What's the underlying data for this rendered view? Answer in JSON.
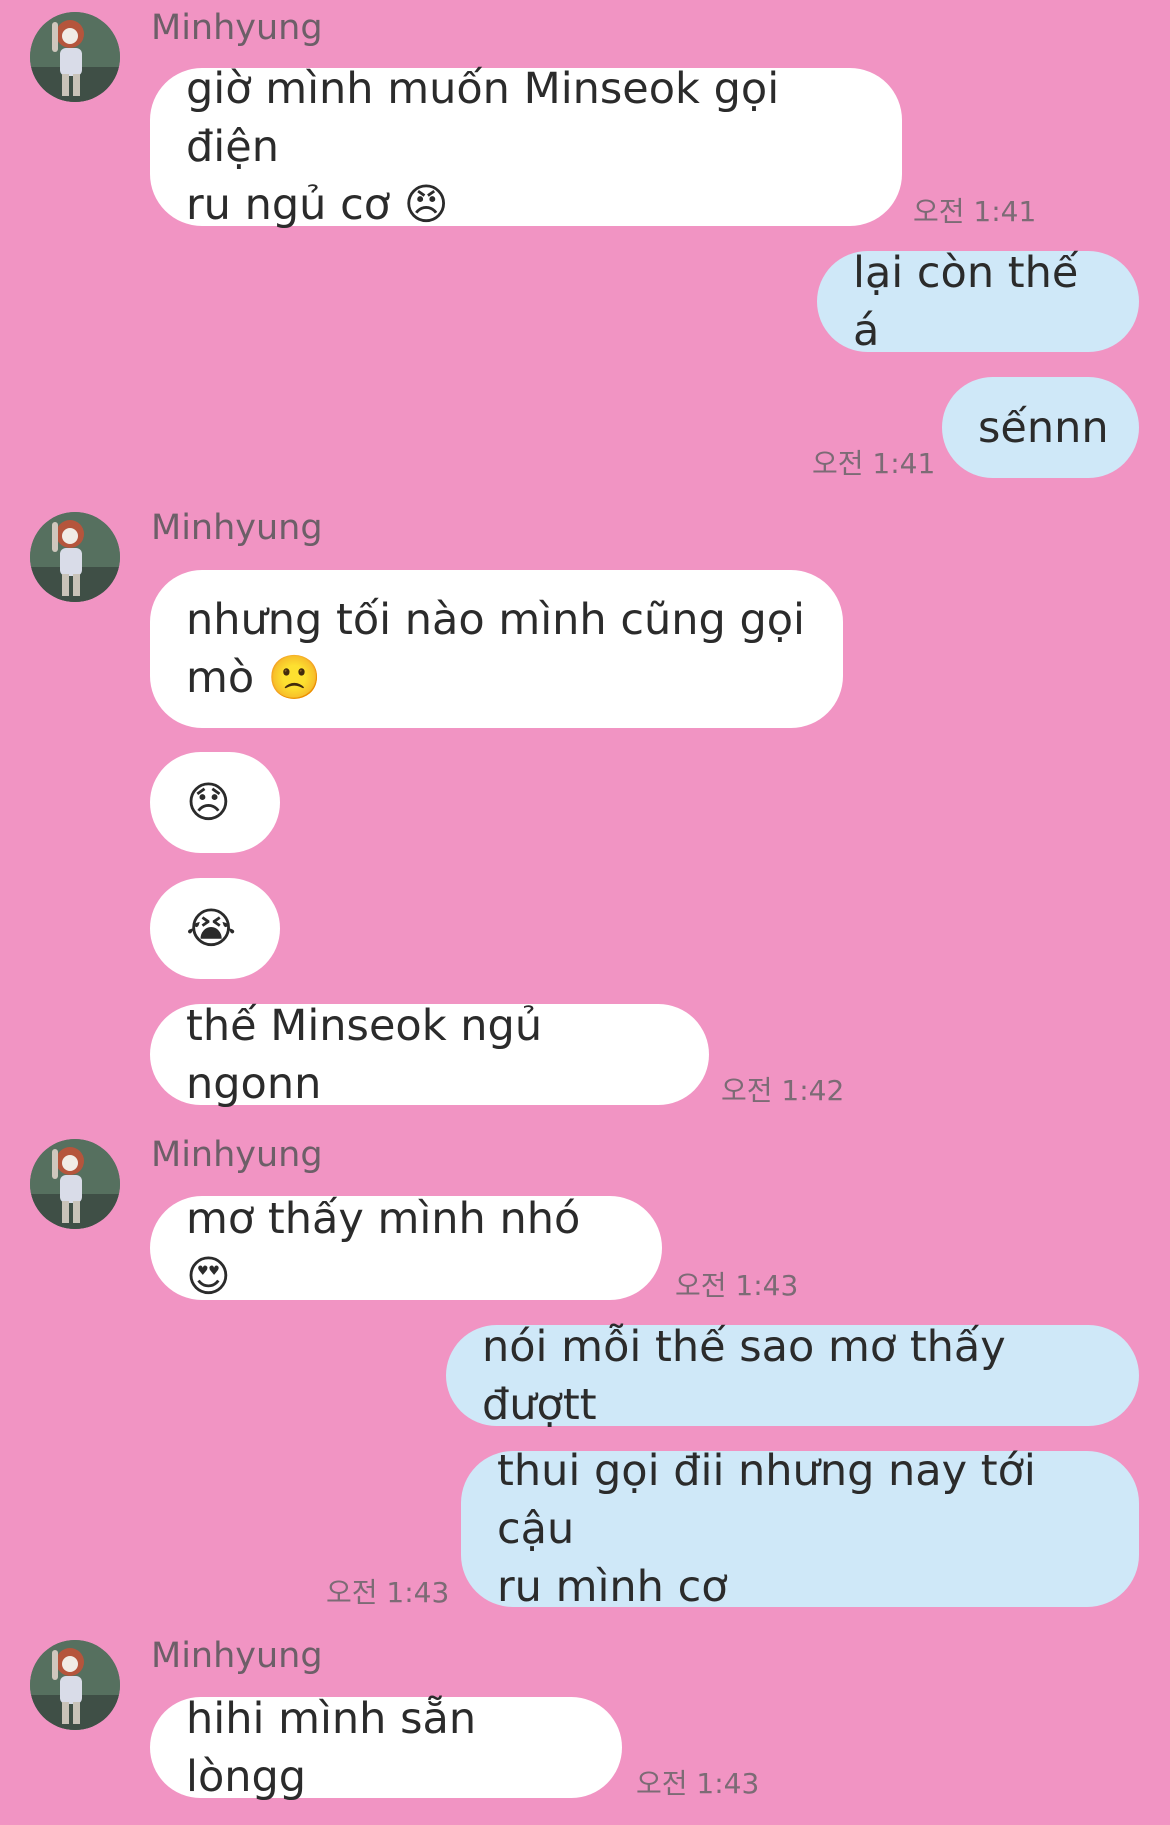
{
  "colors": {
    "background": "#f194c3",
    "incoming_bubble": "#ffffff",
    "outgoing_bubble": "#cfe8f8",
    "text": "#2b2b2b",
    "meta": "#7c6b75"
  },
  "contact": {
    "name": "Minhyung"
  },
  "messages": {
    "m1": {
      "text": "giờ mình muốn Minseok gọi điện\nru ngủ cơ 😠",
      "time": "오전 1:41"
    },
    "m2": {
      "text": "lại còn thế á"
    },
    "m3": {
      "text": "sếnnn",
      "time": "오전 1:41"
    },
    "m4": {
      "text": "nhưng tối nào mình cũng gọi\nmò 🙁"
    },
    "m5": {
      "text": "😞"
    },
    "m6": {
      "text": "😭"
    },
    "m7": {
      "text": "thế Minseok ngủ ngonn",
      "time": "오전 1:42"
    },
    "m8": {
      "text": "mơ thấy mình nhó 😍",
      "time": "오전 1:43"
    },
    "m9": {
      "text": "nói mỗi thế sao mơ thấy đượtt"
    },
    "m10": {
      "text": "thui gọi đii nhưng nay tới cậu\nru mình cơ",
      "time": "오전 1:43"
    },
    "m11": {
      "text": "hihi mình sẵn lòngg",
      "time": "오전 1:43"
    }
  }
}
